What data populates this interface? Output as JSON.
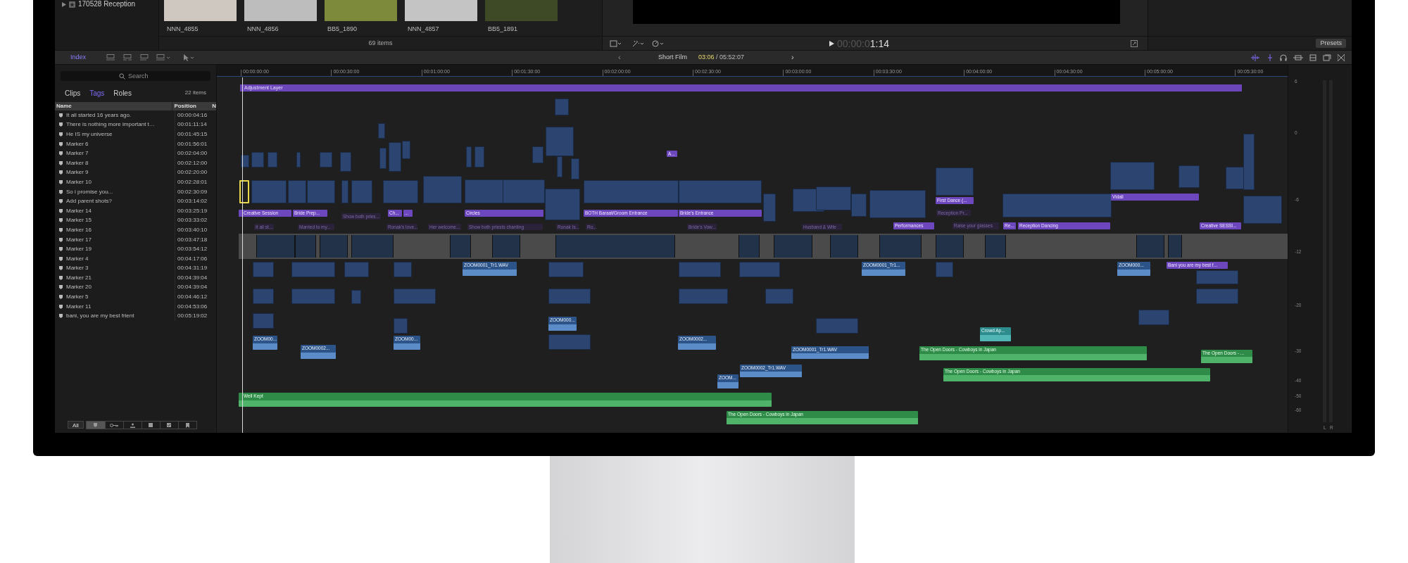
{
  "browser": {
    "event": "170528 Reception",
    "thumbnails": [
      "NNN_4855",
      "NNN_4856",
      "BB5_1890",
      "NNN_4857",
      "BB5_1891"
    ],
    "item_count": "69 items"
  },
  "viewer": {
    "timecode_dim": "00:00:0",
    "timecode": "1:14",
    "presets": "Presets"
  },
  "timeline_bar": {
    "index": "Index",
    "project": "Short Film",
    "position": "03:06",
    "duration": " / 05:52:07",
    "back": "‹",
    "forward": "›"
  },
  "index": {
    "search_placeholder": "Search",
    "tabs": [
      {
        "label": "Clips",
        "selected": false
      },
      {
        "label": "Tags",
        "selected": true
      },
      {
        "label": "Roles",
        "selected": false
      }
    ],
    "count": "22 items",
    "columns": [
      "Name",
      "Position",
      "N"
    ],
    "rows": [
      {
        "name": "It all started 16 years ago.",
        "position": "00:00:04:16"
      },
      {
        "name": "There is nothing more important t…",
        "position": "00:01:11:14"
      },
      {
        "name": "He IS my universe",
        "position": "00:01:45:15"
      },
      {
        "name": "Marker 6",
        "position": "00:01:56:01"
      },
      {
        "name": "Marker 7",
        "position": "00:02:04:00"
      },
      {
        "name": "Marker 8",
        "position": "00:02:12:00"
      },
      {
        "name": "Marker 9",
        "position": "00:02:20:00"
      },
      {
        "name": "Marker 10",
        "position": "00:02:28:01"
      },
      {
        "name": "So i promise you...",
        "position": "00:02:30:09"
      },
      {
        "name": "Add parent shots?",
        "position": "00:03:14:02"
      },
      {
        "name": "Marker 14",
        "position": "00:03:25:19"
      },
      {
        "name": "Marker 15",
        "position": "00:03:33:02"
      },
      {
        "name": "Marker 16",
        "position": "00:03:40:10"
      },
      {
        "name": "Marker 17",
        "position": "00:03:47:18"
      },
      {
        "name": "Marker 19",
        "position": "00:03:54:12"
      },
      {
        "name": "Marker 4",
        "position": "00:04:17:06"
      },
      {
        "name": "Marker 3",
        "position": "00:04:31:19"
      },
      {
        "name": "Marker 21",
        "position": "00:04:39:04"
      },
      {
        "name": "Marker 20",
        "position": "00:04:39:04"
      },
      {
        "name": "Marker 5",
        "position": "00:04:46:12"
      },
      {
        "name": "Marker 11",
        "position": "00:04:53:06"
      },
      {
        "name": "bani, you are my best frient",
        "position": "00:05:19:02"
      }
    ],
    "all_button": "All"
  },
  "timeline": {
    "ruler": [
      "00:00:00:00",
      "00:00:30:00",
      "00:01:00:00",
      "00:01:30:00",
      "00:02:00:00",
      "00:02:30:00",
      "00:03:00:00",
      "00:03:30:00",
      "00:04:00:00",
      "00:04:30:00",
      "00:05:00:00",
      "00:05:30:00"
    ],
    "adjustment_layer": "Adjustment Layer",
    "clips": [
      {
        "kind": "title",
        "label": "Creative Session"
      },
      {
        "kind": "title",
        "label": "Bride Prep..."
      },
      {
        "kind": "title",
        "label": "Ch..."
      },
      {
        "kind": "title",
        "label": "..."
      },
      {
        "kind": "title",
        "label": "Circles"
      },
      {
        "kind": "title",
        "label": "BOTH Baraat/Groom Entrance"
      },
      {
        "kind": "title",
        "label": "Bride's Entrance"
      },
      {
        "kind": "title",
        "label": "A..."
      },
      {
        "kind": "title",
        "label": "First Dance (..."
      },
      {
        "kind": "title",
        "label": "Performances"
      },
      {
        "kind": "title",
        "label": "Re..."
      },
      {
        "kind": "title",
        "label": "Reception Dancing"
      },
      {
        "kind": "title",
        "label": "Vidali"
      },
      {
        "kind": "title",
        "label": "Creative SESSI..."
      },
      {
        "kind": "title",
        "label": "Bani you are my best f..."
      },
      {
        "kind": "faded",
        "label": "It all st..."
      },
      {
        "kind": "faded",
        "label": "Married to my..."
      },
      {
        "kind": "faded",
        "label": "Show both pries..."
      },
      {
        "kind": "faded",
        "label": "Ronak's love..."
      },
      {
        "kind": "faded",
        "label": "Her welcome..."
      },
      {
        "kind": "faded",
        "label": "Show both priests chanting"
      },
      {
        "kind": "faded",
        "label": "Ronak Is..."
      },
      {
        "kind": "faded",
        "label": "Ro..."
      },
      {
        "kind": "faded",
        "label": "Bride's Vow..."
      },
      {
        "kind": "faded",
        "label": "Husband & Wife"
      },
      {
        "kind": "faded",
        "label": "Reception Pr..."
      },
      {
        "kind": "faded",
        "label": "Raise your glasses"
      },
      {
        "kind": "audio",
        "label": "ZOOM0001_Tr1.WAV"
      },
      {
        "kind": "audio",
        "label": "ZOOM0001_Tr1..."
      },
      {
        "kind": "audio",
        "label": "ZOOM000..."
      },
      {
        "kind": "audio",
        "label": "ZOOM00..."
      },
      {
        "kind": "audio",
        "label": "ZOOM0002..."
      },
      {
        "kind": "audio",
        "label": "ZOOM00..."
      },
      {
        "kind": "audio",
        "label": "ZOOM000..."
      },
      {
        "kind": "audio",
        "label": "ZOOM0002..."
      },
      {
        "kind": "audio",
        "label": "ZOOM0001_Tr1.WAV"
      },
      {
        "kind": "audio",
        "label": "ZOOM0002_Tr1.WAV"
      },
      {
        "kind": "audio",
        "label": "ZOOM..."
      },
      {
        "kind": "effect",
        "label": "Crowd Ap..."
      },
      {
        "kind": "music",
        "label": "The Open Doors - Cowboys in Japan"
      },
      {
        "kind": "music",
        "label": "The Open Doors - Cowboys in Japan"
      },
      {
        "kind": "music",
        "label": "The Open Doors - ..."
      },
      {
        "kind": "music",
        "label": "Well Kept"
      },
      {
        "kind": "music",
        "label": "The Open Doors - Cowboys in Japan"
      }
    ],
    "meter_scale": [
      "6",
      "0",
      "-6",
      "-12",
      "-20",
      "-30",
      "-40",
      "-50",
      "-60"
    ],
    "meter_channels": [
      "L",
      "R"
    ]
  }
}
